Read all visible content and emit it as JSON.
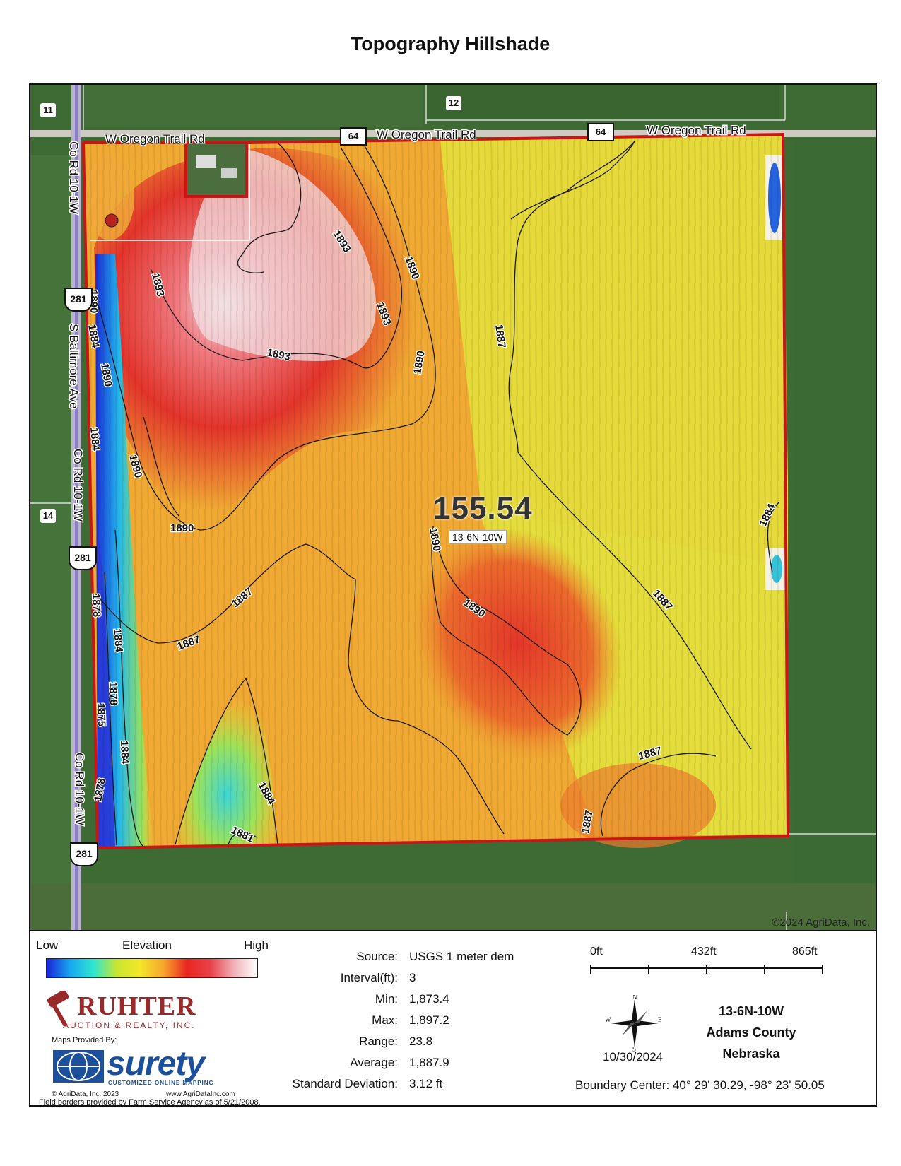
{
  "title": "Topography Hillshade",
  "map": {
    "section_numbers": [
      "11",
      "12",
      "14"
    ],
    "road_labels": {
      "oregon_1": "W Oregon Trail Rd",
      "oregon_2": "W Oregon Trail Rd",
      "oregon_3": "W Oregon Trail Rd",
      "co_rd_1": "Co Rd 10-1W",
      "baltimore": "S Baltimore Ave",
      "co_rd_2": "Co Rd 10-1W",
      "co_rd_3": "Co Rd 10-1W"
    },
    "route_64": "64",
    "route_281": "281",
    "acres": "155.54",
    "parcel_id": "13-6N-10W",
    "copyright": "©2024 AgriData, Inc.",
    "contour_labels": [
      "1893",
      "1893",
      "1893",
      "1893",
      "1890",
      "1890",
      "1890",
      "1890",
      "1890",
      "1890",
      "1890",
      "1890",
      "1887",
      "1887",
      "1887",
      "1887",
      "1887",
      "1887",
      "1884",
      "1884",
      "1884",
      "1884",
      "1884",
      "1884",
      "1881",
      "1878",
      "1878",
      "1878",
      "1875"
    ]
  },
  "legend": {
    "low": "Low",
    "elevation": "Elevation",
    "high": "High",
    "colors": [
      "#1a23d8",
      "#18a7ee",
      "#2fe6d0",
      "#c9e62f",
      "#f4e62a",
      "#f7a52c",
      "#e8271f",
      "#f0b0b8",
      "#ffffff"
    ]
  },
  "stats": [
    {
      "key": "Source:",
      "value": "USGS 1 meter dem"
    },
    {
      "key": "Interval(ft):",
      "value": "3"
    },
    {
      "key": "Min:",
      "value": "1,873.4"
    },
    {
      "key": "Max:",
      "value": "1,897.2"
    },
    {
      "key": "Range:",
      "value": "23.8"
    },
    {
      "key": "Average:",
      "value": "1,887.9"
    },
    {
      "key": "Standard Deviation:",
      "value": "3.12 ft"
    }
  ],
  "scale": {
    "zero": "0ft",
    "mid": "432ft",
    "end": "865ft"
  },
  "compass": {
    "n": "N",
    "s": "S",
    "e": "E",
    "w": "W"
  },
  "date": "10/30/2024",
  "location": {
    "parcel": "13-6N-10W",
    "county": "Adams County",
    "state": "Nebraska"
  },
  "boundary_center": "Boundary Center: 40° 29' 30.29,  -98° 23' 50.05",
  "logos": {
    "ruhter_name": "RUHTER",
    "ruhter_sub": "AUCTION & REALTY, INC.",
    "maps_provided": "Maps Provided By:",
    "surety": "surety",
    "surety_tag": "CUSTOMIZED ONLINE MAPPING",
    "agridata_copy": "© AgriData, Inc. 2023",
    "agridata_url": "www.AgriDataInc.com",
    "field_borders": "Field borders provided by Farm Service Agency as of 5/21/2008."
  }
}
